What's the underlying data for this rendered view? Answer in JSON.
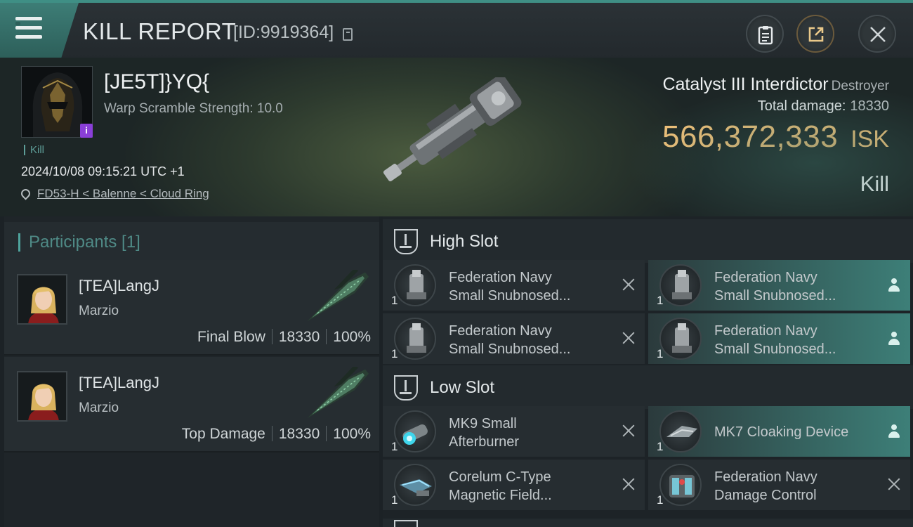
{
  "header": {
    "title": "KILL REPORT",
    "report_id": "[ID:9919364]",
    "buttons": [
      "clipboard",
      "share",
      "close"
    ]
  },
  "victim": {
    "name": "[JE5T]}YQ{",
    "warp_scramble": "Warp Scramble Strength: 10.0",
    "kill_tag": "Kill",
    "datetime": "2024/10/08 09:15:21 UTC +1",
    "location": "FD53-H < Balenne < Cloud Ring",
    "badge": "i"
  },
  "ship": {
    "name": "Catalyst III Interdictor",
    "class": "Destroyer",
    "total_damage_label": "Total damage:",
    "total_damage": "18330",
    "isk_value": "566,372,333",
    "isk_unit": "ISK",
    "status": "Kill"
  },
  "participants": {
    "title": "Participants [1]",
    "rows": [
      {
        "name": "[TEA]LangJ",
        "corp": "Marzio",
        "role": "Final Blow",
        "damage": "18330",
        "percent": "100%"
      },
      {
        "name": "[TEA]LangJ",
        "corp": "Marzio",
        "role": "Top Damage",
        "damage": "18330",
        "percent": "100%"
      }
    ]
  },
  "slots": {
    "high": {
      "title": "High Slot",
      "modules": [
        {
          "line1": "Federation Navy",
          "line2": "Small Snubnosed...",
          "qty": "1",
          "state": "destroyed"
        },
        {
          "line1": "Federation Navy",
          "line2": "Small Snubnosed...",
          "qty": "1",
          "state": "dropped"
        },
        {
          "line1": "Federation Navy",
          "line2": "Small Snubnosed...",
          "qty": "1",
          "state": "destroyed"
        },
        {
          "line1": "Federation Navy",
          "line2": "Small Snubnosed...",
          "qty": "1",
          "state": "dropped"
        }
      ]
    },
    "low": {
      "title": "Low Slot",
      "modules": [
        {
          "line1": "MK9 Small",
          "line2": "Afterburner",
          "qty": "1",
          "state": "destroyed"
        },
        {
          "line1": "MK7 Cloaking Device",
          "line2": "",
          "qty": "1",
          "state": "dropped"
        },
        {
          "line1": "Corelum C-Type",
          "line2": "Magnetic Field...",
          "qty": "1",
          "state": "destroyed"
        },
        {
          "line1": "Federation Navy",
          "line2": "Damage Control",
          "qty": "1",
          "state": "destroyed"
        }
      ]
    }
  },
  "colors": {
    "accent": "#3f8f85",
    "isk": "#f2c27a",
    "highlight": "#3d7f78"
  }
}
